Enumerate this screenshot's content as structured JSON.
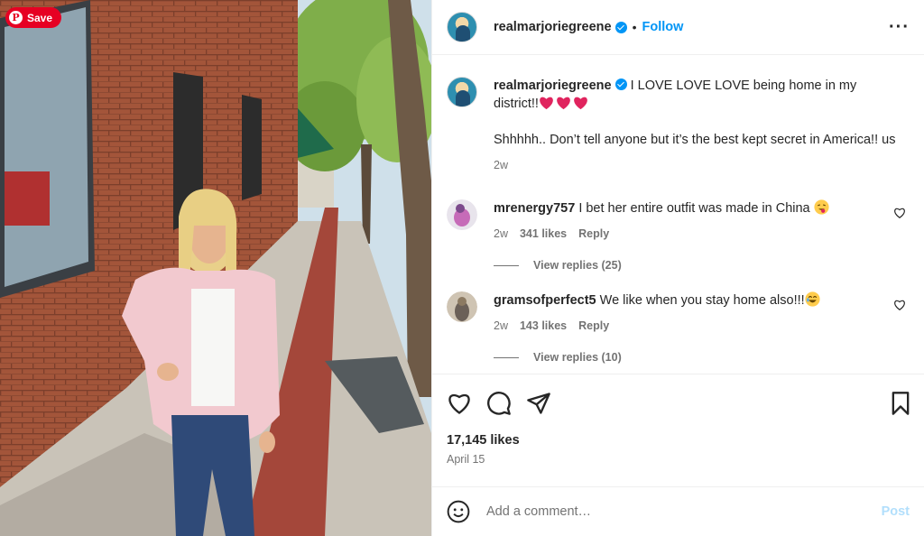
{
  "pin": {
    "save_label": "Save"
  },
  "post": {
    "username": "realmarjoriegreene",
    "follow_label": "Follow",
    "more_icon": "more-horizontal-icon"
  },
  "caption": {
    "username": "realmarjoriegreene",
    "line1": "I LOVE LOVE LOVE being home in my district!!",
    "hearts": [
      "red-heart-emoji",
      "red-heart-emoji",
      "red-heart-emoji"
    ],
    "line2": "Shhhhh.. Don’t tell anyone but it’s the best kept secret in America!! us",
    "time": "2w"
  },
  "comments": [
    {
      "username": "mrenergy757",
      "text": "I bet her entire outfit was made in China",
      "emoji": "face-with-tongue-emoji",
      "time": "2w",
      "likes": "341 likes",
      "reply_label": "Reply",
      "view_replies": "View replies (25)"
    },
    {
      "username": "gramsofperfect5",
      "text": "We like when you stay home also!!!",
      "emoji": "laughing-emoji",
      "time": "2w",
      "likes": "143 likes",
      "reply_label": "Reply",
      "view_replies": "View replies (10)"
    }
  ],
  "footer": {
    "likes": "17,145 likes",
    "date": "April 15",
    "comment_placeholder": "Add a comment…",
    "post_label": "Post"
  },
  "colors": {
    "accent": "#0095f6",
    "save_red": "#e60023",
    "heart_red": "#e0245e"
  }
}
